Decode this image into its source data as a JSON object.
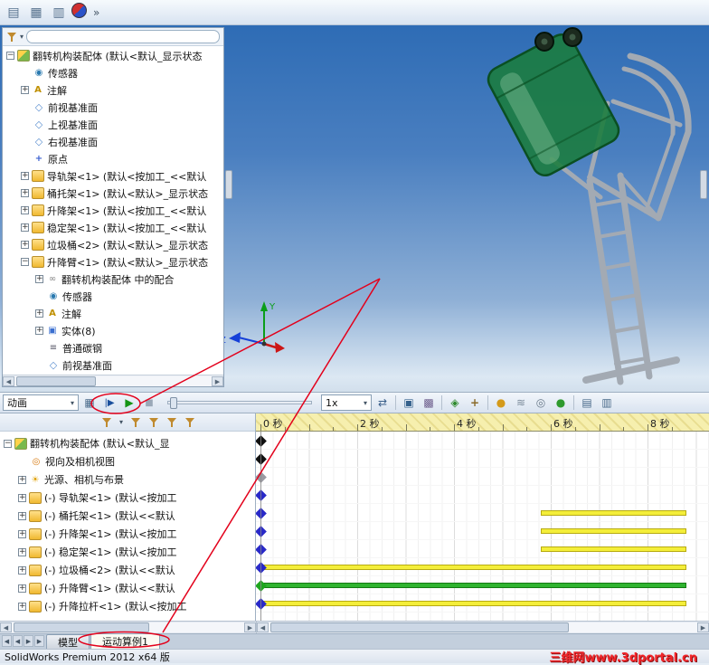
{
  "ui": {
    "caret_down": "▾",
    "arrow_left": "◀",
    "arrow_right": "▶",
    "plus": "+",
    "minus": "−"
  },
  "colors": {
    "annotation_red": "#e3001b",
    "bar_yellow": "#f4ee39",
    "bar_yellow_border": "#b7ab12",
    "bar_green": "#2fb32f",
    "bar_green_border": "#157a15",
    "key_black": "#101010",
    "key_gray": "#9a9aa2",
    "key_blue": "#2929c8",
    "key_green": "#1ea51e"
  },
  "main_toolbar": {
    "overflow_chevron": "»",
    "icons": [
      {
        "name": "new-document",
        "glyph": "▤"
      },
      {
        "name": "open-document",
        "glyph": "▦"
      },
      {
        "name": "window",
        "glyph": "▥"
      },
      {
        "name": "web-resources",
        "glyph": ""
      }
    ]
  },
  "feature_tree": {
    "items": [
      {
        "label": "翻转机构装配体 (默认<默认_显示状态",
        "level": 0,
        "icon": "assembly",
        "exp": "-"
      },
      {
        "label": "传感器",
        "level": 1,
        "icon": "sensors",
        "exp": null
      },
      {
        "label": "注解",
        "level": 1,
        "icon": "annotations",
        "exp": "+"
      },
      {
        "label": "前视基准面",
        "level": 1,
        "icon": "plane",
        "exp": null
      },
      {
        "label": "上视基准面",
        "level": 1,
        "icon": "plane",
        "exp": null
      },
      {
        "label": "右视基准面",
        "level": 1,
        "icon": "plane",
        "exp": null
      },
      {
        "label": "原点",
        "level": 1,
        "icon": "origin",
        "exp": null
      },
      {
        "label": "导轨架<1> (默认<按加工_<<默认",
        "level": 1,
        "icon": "part",
        "exp": "+"
      },
      {
        "label": "桶托架<1> (默认<默认>_显示状态",
        "level": 1,
        "icon": "part",
        "exp": "+"
      },
      {
        "label": "升降架<1> (默认<按加工_<<默认",
        "level": 1,
        "icon": "part",
        "exp": "+"
      },
      {
        "label": "稳定架<1> (默认<按加工_<<默认",
        "level": 1,
        "icon": "part",
        "exp": "+"
      },
      {
        "label": "垃圾桶<2> (默认<默认>_显示状态",
        "level": 1,
        "icon": "part",
        "exp": "+"
      },
      {
        "label": "升降臂<1> (默认<默认>_显示状态",
        "level": 1,
        "icon": "part",
        "exp": "-"
      },
      {
        "label": "翻转机构装配体 中的配合",
        "level": 2,
        "icon": "mates",
        "exp": "+"
      },
      {
        "label": "传感器",
        "level": 2,
        "icon": "sensors",
        "exp": null
      },
      {
        "label": "注解",
        "level": 2,
        "icon": "annotations",
        "exp": "+"
      },
      {
        "label": "实体(8)",
        "level": 2,
        "icon": "solids",
        "exp": "+"
      },
      {
        "label": "普通碳钢",
        "level": 2,
        "icon": "material",
        "exp": null
      },
      {
        "label": "前视基准面",
        "level": 2,
        "icon": "plane",
        "exp": null
      }
    ]
  },
  "viewport": {
    "triad": {
      "y_label": "Y",
      "z_label": "Z"
    }
  },
  "motion_manager": {
    "study_type_label": "动画",
    "speed_label": "1x",
    "toolbar_icons": {
      "calculate": "▦",
      "play_from_start": "|▶",
      "play": "▶",
      "stop": "■",
      "loop_mode": "⇄",
      "save_animation": "▣",
      "animation_wizard": "▩",
      "autokey": "◈",
      "add_key": "+",
      "motor": "●",
      "spring": "≋",
      "contact": "◎",
      "gravity": "●",
      "results": "▤",
      "chart": "▥"
    },
    "tree": [
      {
        "label": "翻转机构装配体 (默认<默认_显",
        "level": 0,
        "icon": "assembly",
        "exp": "-"
      },
      {
        "label": "视向及相机视图",
        "level": 1,
        "icon": "camera",
        "exp": null
      },
      {
        "label": "光源、相机与布景",
        "level": 1,
        "icon": "lights",
        "exp": "+"
      },
      {
        "label": "(-) 导轨架<1> (默认<按加工",
        "level": 1,
        "icon": "part",
        "exp": "+"
      },
      {
        "label": "(-) 桶托架<1> (默认<<默认",
        "level": 1,
        "icon": "part",
        "exp": "+"
      },
      {
        "label": "(-) 升降架<1> (默认<按加工",
        "level": 1,
        "icon": "part",
        "exp": "+"
      },
      {
        "label": "(-) 稳定架<1> (默认<按加工",
        "level": 1,
        "icon": "part",
        "exp": "+"
      },
      {
        "label": "(-) 垃圾桶<2> (默认<<默认",
        "level": 1,
        "icon": "part",
        "exp": "+"
      },
      {
        "label": "(-) 升降臂<1> (默认<<默认",
        "level": 1,
        "icon": "part",
        "exp": "+"
      },
      {
        "label": "(-) 升降拉杆<1> (默认<按加工",
        "level": 1,
        "icon": "part",
        "exp": "+"
      }
    ],
    "timeline": {
      "tick_labels": [
        "0 秒",
        "2 秒",
        "4 秒",
        "6 秒",
        "8 秒"
      ],
      "seconds_per_label": 2,
      "rows": [
        {
          "key": "black",
          "bar": null
        },
        {
          "key": "black",
          "bar": null
        },
        {
          "key": "gray",
          "bar": null
        },
        {
          "key": "blue",
          "bar": null
        },
        {
          "key": "blue",
          "bar": {
            "start": 5.8,
            "end": 8.8,
            "color": "yellow"
          }
        },
        {
          "key": "blue",
          "bar": {
            "start": 5.8,
            "end": 8.8,
            "color": "yellow"
          }
        },
        {
          "key": "blue",
          "bar": {
            "start": 5.8,
            "end": 8.8,
            "color": "yellow"
          }
        },
        {
          "key": "blue",
          "bar": {
            "start": 0,
            "end": 8.8,
            "color": "yellow"
          }
        },
        {
          "key": "green",
          "bar": {
            "start": 0,
            "end": 8.8,
            "color": "green"
          }
        },
        {
          "key": "blue",
          "bar": {
            "start": 0,
            "end": 8.8,
            "color": "yellow"
          }
        }
      ]
    }
  },
  "tabs": {
    "items": [
      {
        "label": "模型",
        "name": "model-tab",
        "active": false
      },
      {
        "label": "运动算例1",
        "name": "motion-study-tab",
        "active": true
      }
    ]
  },
  "status_bar": {
    "text": "SolidWorks Premium 2012 x64 版",
    "watermark": "三维网www.3dportal.cn"
  }
}
